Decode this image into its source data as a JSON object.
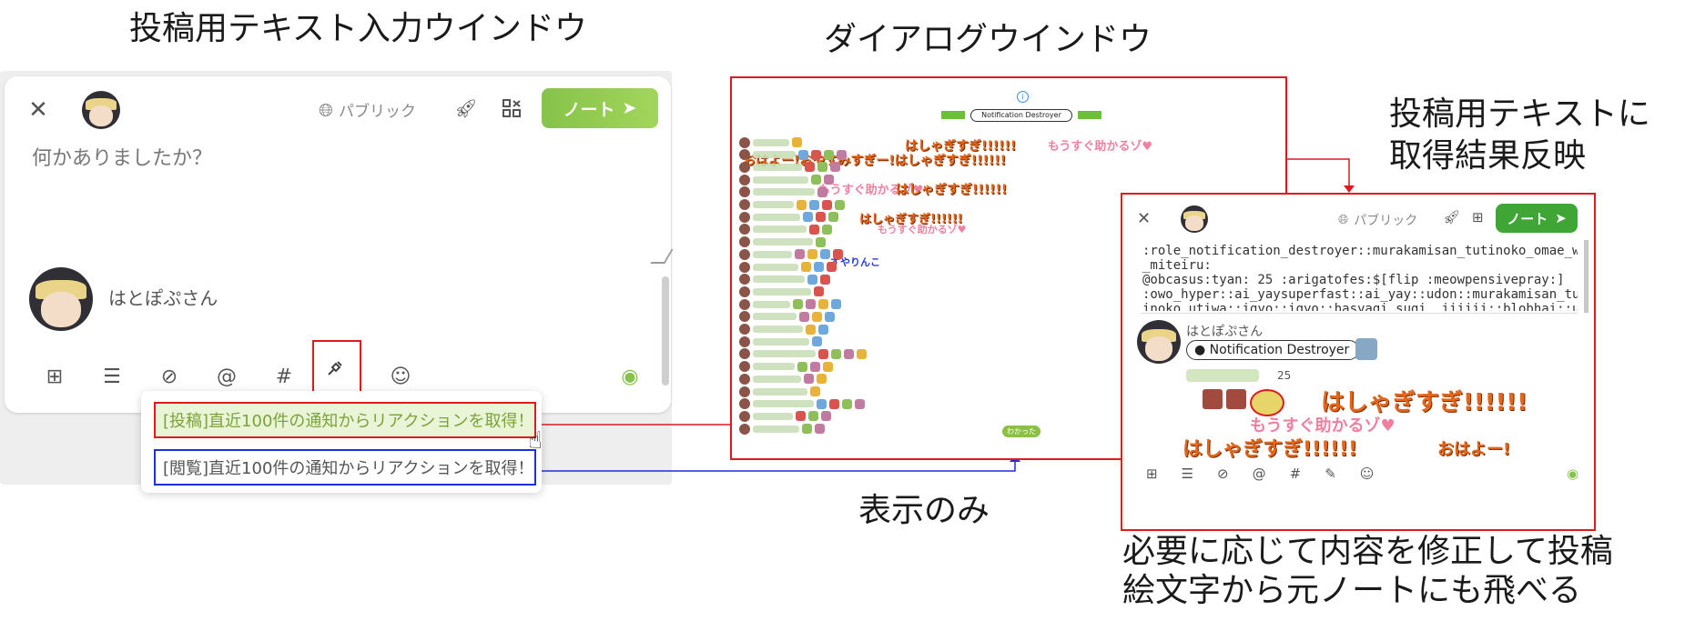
{
  "captions": {
    "compose_title": "投稿用テキスト入力ウインドウ",
    "dialog_title": "ダイアログウインドウ",
    "result_title_line1": "投稿用テキストに",
    "result_title_line2": "取得結果反映",
    "display_only": "表示のみ",
    "bottom_line1": "必要に応じて内容を修正して投稿",
    "bottom_line2": "絵文字から元ノートにも飛べる"
  },
  "compose": {
    "visibility_label": "パブリック",
    "note_button_label": "ノート",
    "placeholder": "何かありましたか？",
    "user_name": "はとぽぷさん",
    "menu_post": "[投稿]直近100件の通知からリアクションを取得！",
    "menu_view": "[閲覧]直近100件の通知からリアクションを取得！"
  },
  "dialog": {
    "badge_label": "Notification Destroyer",
    "line1": "はしゃぎすぎ!!!!!!",
    "line2": "もうすぐ助かるゾ♥",
    "line3": "おはよー!おやすみすぎー!はしゃぎすぎ!!!!!!",
    "line4": "すやりんこ",
    "count": "25",
    "ok_button": "わかった"
  },
  "result": {
    "visibility_label": "パブリック",
    "note_button_label": "ノート",
    "text_lines": [
      ":role_notification_destroyer::murakamisan_tutinoko_omae_wo",
      "_miteiru:",
      "@obcasus:tyan: 25 :arigatofes:$[flip :meowpensivepray:]",
      ":owo_hyper::ai_yaysuperfast::ai_yay::udon::murakamisan_tut",
      "inoko_utiwa::igyo::igyo::hasyagi_sugi__iiiiii::blobhai::uw"
    ],
    "user_name": "はとぽぷさん",
    "badge_label": "Notification Destroyer",
    "count": "25",
    "big_text_1": "はしゃぎすぎ!!!!!!",
    "pink_text": "もうすぐ助かるゾ♥",
    "big_text_2": "はしゃぎすぎ!!!!!!",
    "ohayo": "おはよー!"
  },
  "colors": {
    "highlight_red": "#e0191d",
    "highlight_blue": "#1f2fd8",
    "accent_green": "#86c34a"
  }
}
